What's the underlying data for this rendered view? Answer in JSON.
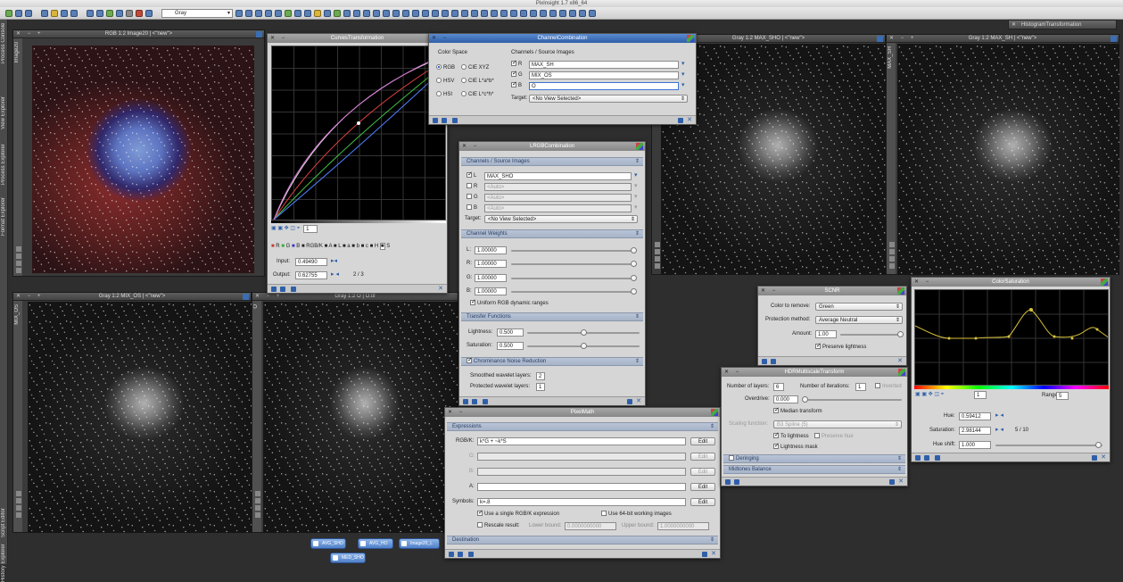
{
  "app": {
    "title": "PixInsight 1.7 x86_64"
  },
  "toolbar": {
    "color_mode": "Gray"
  },
  "sidebar": {
    "tabs": [
      "Process Console",
      "View Explorer",
      "Process Explorer",
      "Format Explorer",
      "Script Editor",
      "History Explorer"
    ]
  },
  "windows": {
    "image20": {
      "title": "RGB 1:2 Image20 | <\"new\">",
      "strip": "Image20"
    },
    "max_sho": {
      "title": "Gray 1:2 MAX_SHO | <\"new\">"
    },
    "max_sh": {
      "title": "Gray 1:2 MAX_SH | <\"new\">",
      "strip": "MAX_SH"
    },
    "mix_os": {
      "title": "Gray 1:2 MIX_OS | <\"new\">",
      "strip": "MIX_OS"
    },
    "o_tif": {
      "title": "Gray 1:2 O | O.tif",
      "strip": "O"
    }
  },
  "histogram_tab": "HistogramTransformation",
  "curves": {
    "title": "CurvesTransformation",
    "channels": [
      "R",
      "G",
      "B",
      "RGB/K",
      "A",
      "L",
      "a",
      "b",
      "c",
      "H",
      "S"
    ],
    "zoom": "1",
    "input_label": "Input:",
    "input_value": "0.49490",
    "output_label": "Output:",
    "output_value": "0.62755",
    "point_counter": "2 / 3"
  },
  "channel_combination": {
    "title": "ChannelCombination",
    "color_space_label": "Color Space",
    "color_spaces": [
      "RGB",
      "CIE XYZ",
      "HSV",
      "CIE L*a*b*",
      "HSI",
      "CIE L*c*h*"
    ],
    "channels_label": "Channels / Source Images",
    "channels": [
      {
        "label": "R",
        "value": "MAX_SH"
      },
      {
        "label": "G",
        "value": "MIX_OS"
      },
      {
        "label": "B",
        "value": "O"
      }
    ],
    "target_label": "Target:",
    "target_value": "<No View Selected>"
  },
  "lrgb": {
    "title": "LRGBCombination",
    "sec_channels": "Channels / Source Images",
    "channels": [
      {
        "label": "L",
        "value": "MAX_SHO",
        "checked": true
      },
      {
        "label": "R",
        "value": "<Auto>",
        "checked": false
      },
      {
        "label": "G",
        "value": "<Auto>",
        "checked": false
      },
      {
        "label": "B",
        "value": "<Auto>",
        "checked": false
      }
    ],
    "target_label": "Target:",
    "target_value": "<No View Selected>",
    "sec_weights": "Channel Weights",
    "weights": [
      {
        "label": "L:",
        "value": "1.00000"
      },
      {
        "label": "R:",
        "value": "1.00000"
      },
      {
        "label": "G:",
        "value": "1.00000"
      },
      {
        "label": "B:",
        "value": "1.00000"
      }
    ],
    "uniform_label": "Uniform RGB dynamic ranges",
    "sec_transfer": "Transfer Functions",
    "lightness_label": "Lightness:",
    "lightness_value": "0.500",
    "saturation_label": "Saturation:",
    "saturation_value": "0.500",
    "sec_noise": "Chrominance Noise Reduction",
    "smoothed_label": "Smoothed wavelet layers:",
    "smoothed_value": "2",
    "protected_label": "Protected wavelet layers:",
    "protected_value": "1"
  },
  "pixelmath": {
    "title": "PixelMath",
    "sec_expressions": "Expressions",
    "rows": [
      {
        "label": "RGB/K:",
        "value": "k*G + ~k*S"
      },
      {
        "label": "G:",
        "value": ""
      },
      {
        "label": "B:",
        "value": ""
      },
      {
        "label": "A:",
        "value": ""
      }
    ],
    "edit_label": "Edit",
    "symbols_label": "Symbols:",
    "symbols_value": "k=.8",
    "single_expr_label": "Use a single RGB/K expression",
    "use64_label": "Use 64-bit working images",
    "rescale_label": "Rescale result:",
    "lower_label": "Lower bound:",
    "lower_value": "0.0000000000",
    "upper_label": "Upper bound:",
    "upper_value": "1.0000000000",
    "sec_destination": "Destination"
  },
  "scnr": {
    "title": "SCNR",
    "color_label": "Color to remove:",
    "color_value": "Green",
    "method_label": "Protection method:",
    "method_value": "Average Neutral",
    "amount_label": "Amount:",
    "amount_value": "1.00",
    "preserve_label": "Preserve lightness"
  },
  "hdr": {
    "title": "HDRMultiscaleTransform",
    "layers_label": "Number of layers:",
    "layers_value": "6",
    "iter_label": "Number of iterations:",
    "iter_value": "1",
    "inverted_label": "Inverted",
    "overdrive_label": "Overdrive:",
    "overdrive_value": "0.000",
    "median_label": "Median transform",
    "scaling_label": "Scaling function:",
    "scaling_value": "B3 Spline (5)",
    "to_lightness_label": "To lightness",
    "preserve_hue_label": "Preserve hue",
    "mask_label": "Lightness mask",
    "sec_deringing": "Deringing",
    "sec_midtones": "Midtones Balance"
  },
  "color_saturation": {
    "title": "ColorSaturation",
    "zoom": "1",
    "range_label": "Range:",
    "range_value": "5",
    "hue_label": "Hue:",
    "hue_value": "0.59412",
    "saturation_label": "Saturation:",
    "saturation_value": "2.98144",
    "point_counter": "5 / 10",
    "hue_shift_label": "Hue shift:",
    "hue_shift_value": "1.000"
  },
  "taskbar": [
    "AVG_SHO",
    "AVG_HO",
    "Image20_L",
    "MED_SHO"
  ]
}
